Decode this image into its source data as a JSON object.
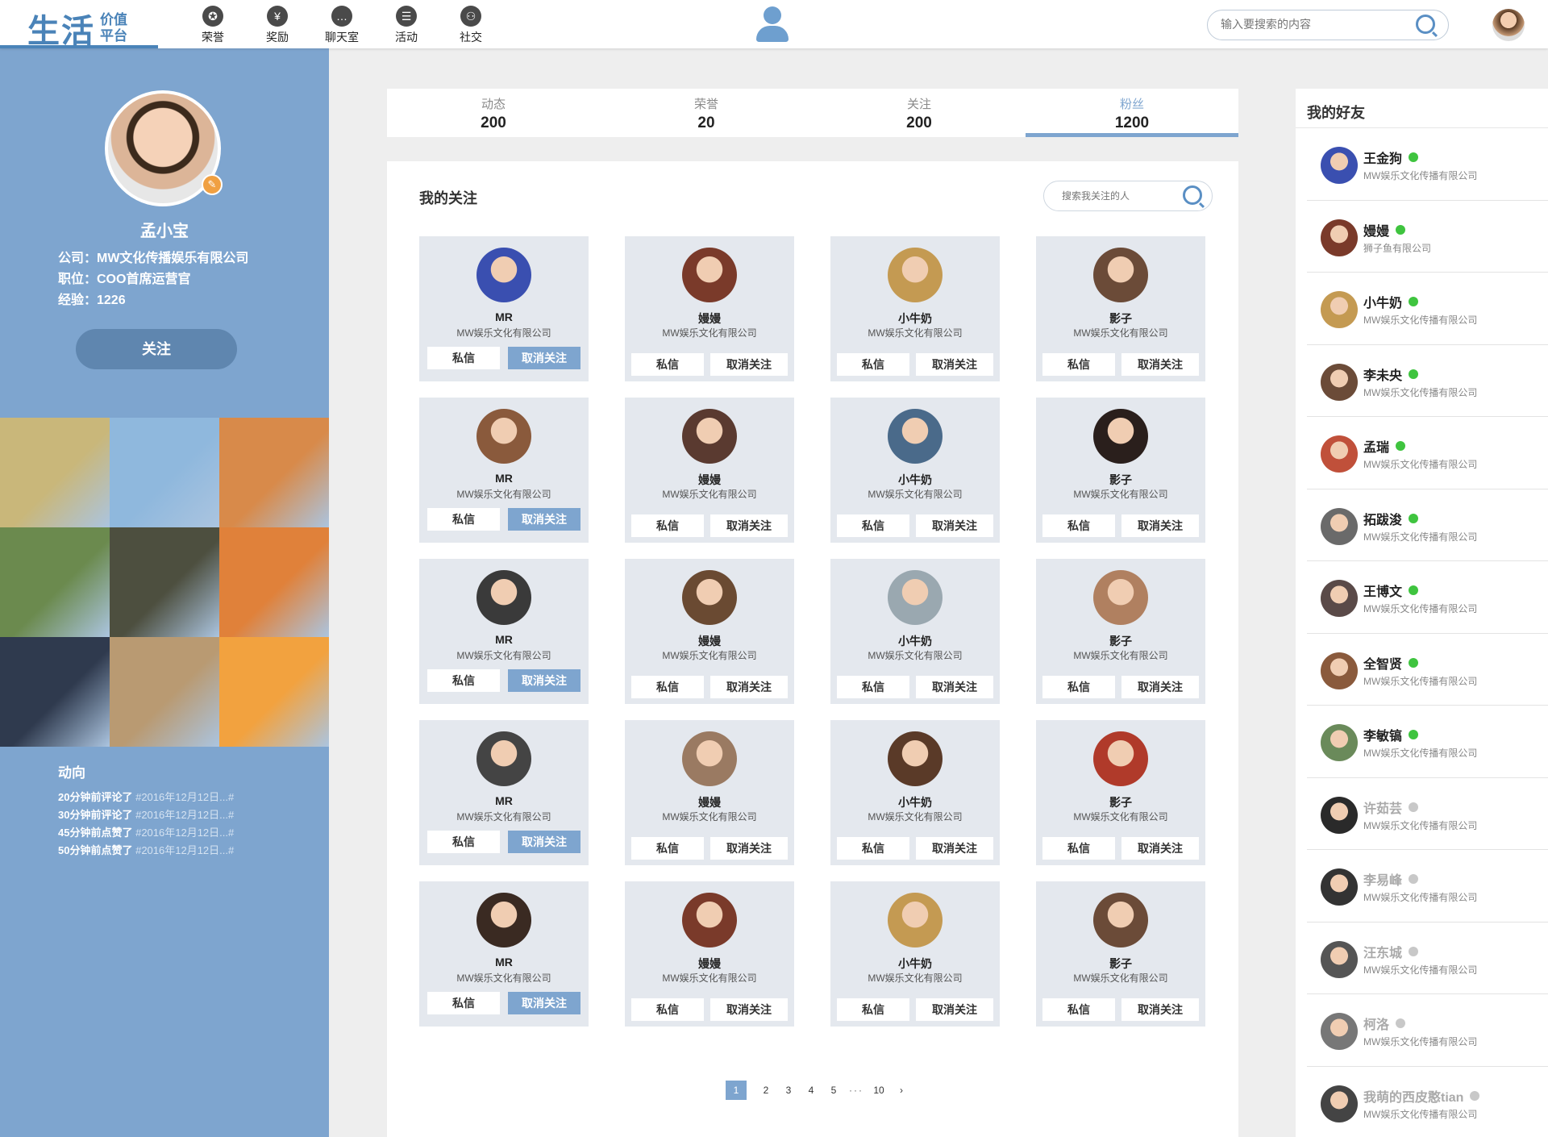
{
  "brand": {
    "main": "生活",
    "sub_top": "价值",
    "sub_bottom": "平台",
    "color": "#4a83b8"
  },
  "nav": [
    {
      "label": "荣誉",
      "icon": "medal-icon",
      "glyph": "✪"
    },
    {
      "label": "奖励",
      "icon": "money-bag-icon",
      "glyph": "¥"
    },
    {
      "label": "聊天室",
      "icon": "chat-icon",
      "glyph": "…"
    },
    {
      "label": "活动",
      "icon": "calendar-icon",
      "glyph": "☰"
    },
    {
      "label": "社交",
      "icon": "social-icon",
      "glyph": "⚇"
    }
  ],
  "search": {
    "placeholder": "输入要搜索的内容"
  },
  "profile": {
    "name": "孟小宝",
    "company": "公司：MW文化传播娱乐有限公司",
    "position": "职位：COO首席运营官",
    "experience": "经验：1226",
    "follow_label": "关注"
  },
  "photos": [
    "#c9b77a",
    "#8fb8dd",
    "#d88a4a",
    "#6b8a4e",
    "#4d4f3f",
    "#e0813a",
    "#2f3a4e",
    "#b99a72",
    "#f2a23f"
  ],
  "activity": {
    "title": "动向",
    "items": [
      {
        "text": "20分钟前评论了",
        "tag": "#2016年12月12日...#"
      },
      {
        "text": "30分钟前评论了",
        "tag": "#2016年12月12日...#"
      },
      {
        "text": "45分钟前点赞了",
        "tag": "#2016年12月12日...#"
      },
      {
        "text": "50分钟前点赞了",
        "tag": "#2016年12月12日...#"
      }
    ]
  },
  "stats": [
    {
      "label": "动态",
      "value": "200"
    },
    {
      "label": "荣誉",
      "value": "20"
    },
    {
      "label": "关注",
      "value": "200"
    },
    {
      "label": "粉丝",
      "value": "1200"
    }
  ],
  "stats_active_index": 3,
  "follow_panel": {
    "title": "我的关注",
    "search_placeholder": "搜索我关注的人",
    "dm_label": "私信",
    "unfollow_label": "取消关注"
  },
  "follow_cards": [
    {
      "name": "MR",
      "company": "MW娱乐文化有限公司",
      "avatar": "#3a4fb0"
    },
    {
      "name": "嫚嫚",
      "company": "MW娱乐文化有限公司",
      "avatar": "#7a3a2a"
    },
    {
      "name": "小牛奶",
      "company": "MW娱乐文化有限公司",
      "avatar": "#c49a52"
    },
    {
      "name": "影子",
      "company": "MW娱乐文化有限公司",
      "avatar": "#6b4b38"
    },
    {
      "name": "MR",
      "company": "MW娱乐文化有限公司",
      "avatar": "#8a5a3c"
    },
    {
      "name": "嫚嫚",
      "company": "MW娱乐文化有限公司",
      "avatar": "#5a3a30"
    },
    {
      "name": "小牛奶",
      "company": "MW娱乐文化有限公司",
      "avatar": "#4a6a8a"
    },
    {
      "name": "影子",
      "company": "MW娱乐文化有限公司",
      "avatar": "#2a1f1c"
    },
    {
      "name": "MR",
      "company": "MW娱乐文化有限公司",
      "avatar": "#3a3a3a"
    },
    {
      "name": "嫚嫚",
      "company": "MW娱乐文化有限公司",
      "avatar": "#6a4a32"
    },
    {
      "name": "小牛奶",
      "company": "MW娱乐文化有限公司",
      "avatar": "#9aa8b0"
    },
    {
      "name": "影子",
      "company": "MW娱乐文化有限公司",
      "avatar": "#b08060"
    },
    {
      "name": "MR",
      "company": "MW娱乐文化有限公司",
      "avatar": "#444444"
    },
    {
      "name": "嫚嫚",
      "company": "MW娱乐文化有限公司",
      "avatar": "#9a7a62"
    },
    {
      "name": "小牛奶",
      "company": "MW娱乐文化有限公司",
      "avatar": "#5a3a28"
    },
    {
      "name": "影子",
      "company": "MW娱乐文化有限公司",
      "avatar": "#b03a2a"
    },
    {
      "name": "MR",
      "company": "MW娱乐文化有限公司",
      "avatar": "#3a2a22"
    },
    {
      "name": "嫚嫚",
      "company": "MW娱乐文化有限公司",
      "avatar": "#7a3a2a"
    },
    {
      "name": "小牛奶",
      "company": "MW娱乐文化有限公司",
      "avatar": "#c49a52"
    },
    {
      "name": "影子",
      "company": "MW娱乐文化有限公司",
      "avatar": "#6b4b38"
    }
  ],
  "pagination": [
    "1",
    "2",
    "3",
    "4",
    "5",
    "···",
    "10",
    "›"
  ],
  "pagination_active": "1",
  "friends": {
    "title": "我的好友",
    "online_color": "#3fc43f",
    "offline_color": "#c8c8c8",
    "items": [
      {
        "name": "王金狗",
        "company": "MW娱乐文化传播有限公司",
        "online": true,
        "avatar": "#3a4fb0"
      },
      {
        "name": "嫚嫚",
        "company": "狮子鱼有限公司",
        "online": true,
        "avatar": "#7a3a2a"
      },
      {
        "name": "小牛奶",
        "company": "MW娱乐文化传播有限公司",
        "online": true,
        "avatar": "#c49a52"
      },
      {
        "name": "李未央",
        "company": "MW娱乐文化传播有限公司",
        "online": true,
        "avatar": "#6b4b38"
      },
      {
        "name": "孟瑞",
        "company": "MW娱乐文化传播有限公司",
        "online": true,
        "avatar": "#c0503a"
      },
      {
        "name": "拓跋浚",
        "company": "MW娱乐文化传播有限公司",
        "online": true,
        "avatar": "#6a6a6a"
      },
      {
        "name": "王博文",
        "company": "MW娱乐文化传播有限公司",
        "online": true,
        "avatar": "#5a4a48"
      },
      {
        "name": "全智贤",
        "company": "MW娱乐文化传播有限公司",
        "online": true,
        "avatar": "#8a5a3c"
      },
      {
        "name": "李敏镐",
        "company": "MW娱乐文化传播有限公司",
        "online": true,
        "avatar": "#6a8a5a"
      },
      {
        "name": "许茹芸",
        "company": "MW娱乐文化传播有限公司",
        "online": false,
        "avatar": "#2a2a2a"
      },
      {
        "name": "李易峰",
        "company": "MW娱乐文化传播有限公司",
        "online": false,
        "avatar": "#333333"
      },
      {
        "name": "汪东城",
        "company": "MW娱乐文化传播有限公司",
        "online": false,
        "avatar": "#555555"
      },
      {
        "name": "柯洛",
        "company": "MW娱乐文化传播有限公司",
        "online": false,
        "avatar": "#777777"
      },
      {
        "name": "我萌的西皮憨tian",
        "company": "MW娱乐文化传播有限公司",
        "online": false,
        "avatar": "#444444"
      }
    ]
  }
}
